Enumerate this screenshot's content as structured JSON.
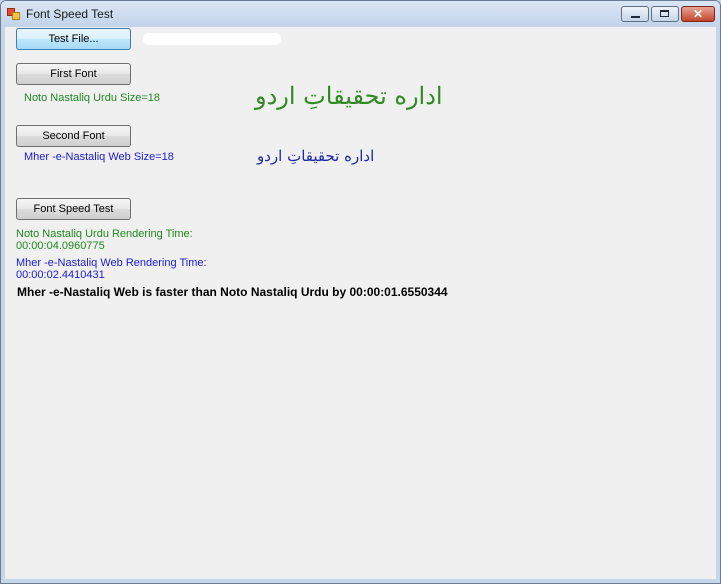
{
  "window": {
    "title": "Font Speed Test",
    "close_glyph": "✕"
  },
  "buttons": {
    "test_file": "Test File...",
    "first_font": "First Font",
    "second_font": "Second Font",
    "font_speed_test": "Font Speed Test"
  },
  "fonts": {
    "first_label": "Noto Nastaliq Urdu Size=18",
    "second_label": "Mher -e-Nastaliq Web Size=18",
    "urdu_sample_1": "اداره تحقیقاتِ اردو",
    "urdu_sample_2": "اداره تحقیقاتِ اردو"
  },
  "results": {
    "noto_label": "Noto Nastaliq Urdu Rendering Time:",
    "noto_time": "00:00:04.0960775",
    "mher_label": "Mher -e-Nastaliq Web Rendering Time:",
    "mher_time": "00:00:02.4410431",
    "summary": "Mher -e-Nastaliq Web is faster than Noto Nastaliq Urdu by 00:00:01.6550344"
  },
  "colors": {
    "green": "#1f8a1f",
    "blue": "#1a1ad6"
  }
}
